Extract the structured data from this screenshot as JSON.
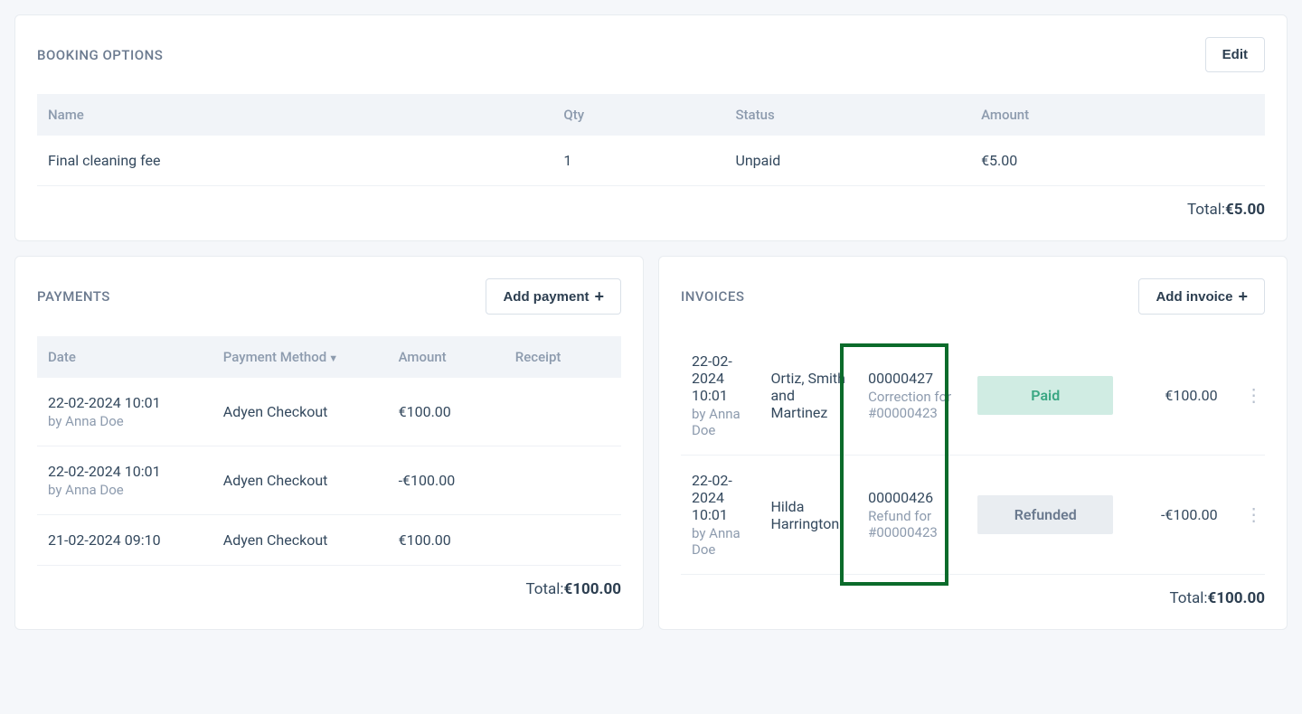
{
  "booking_options": {
    "title": "BOOKING OPTIONS",
    "edit_label": "Edit",
    "headers": {
      "name": "Name",
      "qty": "Qty",
      "status": "Status",
      "amount": "Amount"
    },
    "rows": [
      {
        "name": "Final cleaning fee",
        "qty": "1",
        "status": "Unpaid",
        "amount": "€5.00"
      }
    ],
    "total_label": "Total:",
    "total_value": "€5.00"
  },
  "payments": {
    "title": "PAYMENTS",
    "add_label": "Add payment",
    "headers": {
      "date": "Date",
      "method": "Payment Method",
      "amount": "Amount",
      "receipt": "Receipt"
    },
    "rows": [
      {
        "date": "22-02-2024 10:01",
        "by": "by Anna Doe",
        "method": "Adyen Checkout",
        "amount": "€100.00"
      },
      {
        "date": "22-02-2024 10:01",
        "by": "by Anna Doe",
        "method": "Adyen Checkout",
        "amount": "-€100.00"
      },
      {
        "date": "21-02-2024 09:10",
        "by": "",
        "method": "Adyen Checkout",
        "amount": "€100.00"
      }
    ],
    "total_label": "Total:",
    "total_value": "€100.00"
  },
  "invoices": {
    "title": "INVOICES",
    "add_label": "Add invoice",
    "rows": [
      {
        "date": "22-02-2024 10:01",
        "by": "by Anna Doe",
        "customer": "Ortiz, Smith and Martinez",
        "number": "00000427",
        "note": "Correction for #00000423",
        "status": "Paid",
        "status_class": "paid",
        "amount": "€100.00"
      },
      {
        "date": "22-02-2024 10:01",
        "by": "by Anna Doe",
        "customer": "Hilda Harrington",
        "number": "00000426",
        "note": "Refund for #00000423",
        "status": "Refunded",
        "status_class": "refunded",
        "amount": "-€100.00"
      }
    ],
    "total_label": "Total:",
    "total_value": "€100.00"
  }
}
